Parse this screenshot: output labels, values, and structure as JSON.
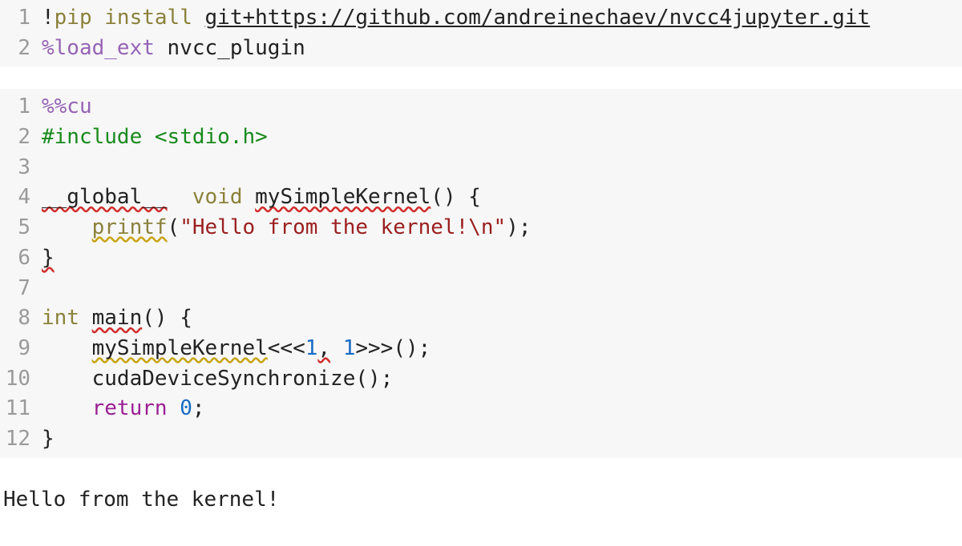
{
  "cell1": {
    "lines": {
      "l1": {
        "num": "1",
        "bang": "!",
        "pip": "pip",
        "sp1": " ",
        "install": "install",
        "sp2": " ",
        "url": "git+https://github.com/andreinechaev/nvcc4jupyter.git"
      },
      "l2": {
        "num": "2",
        "magic": "%load_ext",
        "sp": " ",
        "arg": "nvcc_plugin"
      }
    }
  },
  "cell2": {
    "lines": {
      "l1": {
        "num": "1",
        "magic": "%%cu"
      },
      "l2": {
        "num": "2",
        "inc": "#include",
        "sp": " ",
        "hdr": "<stdio.h>"
      },
      "l3": {
        "num": "3",
        "blank": ""
      },
      "l4": {
        "num": "4",
        "glob": "__global__",
        "sp1": "  ",
        "void": "void",
        "sp2": " ",
        "fn": "mySimpleKernel",
        "paren": "()",
        "sp3": " ",
        "brace": "{"
      },
      "l5": {
        "num": "5",
        "indent": "    ",
        "printf": "printf",
        "lp": "(",
        "str": "\"Hello from the kernel!\\n\"",
        "rp": ")",
        "semi": ";"
      },
      "l6": {
        "num": "6",
        "brace": "}"
      },
      "l7": {
        "num": "7",
        "blank": ""
      },
      "l8": {
        "num": "8",
        "int": "int",
        "sp1": " ",
        "main": "main",
        "paren": "()",
        "sp2": " ",
        "brace": "{"
      },
      "l9": {
        "num": "9",
        "indent": "    ",
        "fn": "mySimpleKernel",
        "l3": "<<<",
        "a": "1",
        "comma": ",",
        "sp": " ",
        "b": "1",
        "r3": ">>>",
        "paren": "()",
        "semi": ";"
      },
      "l10": {
        "num": "10",
        "indent": "    ",
        "fn": "cudaDeviceSynchronize",
        "paren": "()",
        "semi": ";"
      },
      "l11": {
        "num": "11",
        "indent": "    ",
        "ret": "return",
        "sp": " ",
        "zero": "0",
        "semi": ";"
      },
      "l12": {
        "num": "12",
        "brace": "}"
      }
    }
  },
  "output": "Hello from the kernel!"
}
